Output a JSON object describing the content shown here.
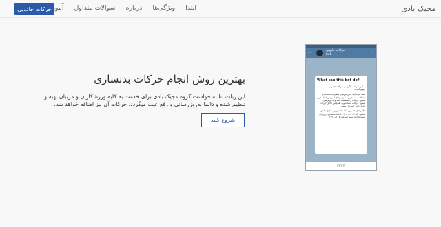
{
  "nav": {
    "brand": "مجیک بادی",
    "links": [
      "ابتدا",
      "ویژگی‌ها",
      "درباره",
      "سوالات متداول",
      "آموزش"
    ],
    "cta": "حرکات جادویی"
  },
  "hero": {
    "title": "بهترین روش انجام حرکات بدنسازی",
    "text": "این ربات بنا به خواست گروه مجیک بادی برای خدمت به کلیه ورزشکاران و مربیان تهیه و تنظیم شده و دائما به‌روزرسانی و رفع عیب میگردد، حرکات آن نیز اضافه خواهد شد.",
    "button": "شروع کنید"
  },
  "phone": {
    "header_name": "حرکات جادویی",
    "header_sub": "bot",
    "bubble_title": "What can this bot do?",
    "bubble_p1": "سلام به ربات تلگرامی حرکات جادویی خوش‌آمدید.",
    "bubble_p2": "شما می‌توانید به روش‌های متفاوت(دسته‌بندی عضلات، جستجو و...) ویدیوهای آموزش انجام فرم صحیح حرکات را مشاهده کنید و با روش‌های صحیح حرکات آشنا شوید. همچنین داخل حرکات جدید را نیز آموزش ببینید.",
    "bubble_p3": "کلاس‌های حضوری با استاد فرزین عباری: تلفن تماس: ۱۴۰۴۲۵۳ - ۰۹۱۲ ساعات تماس: روزهای شنبه تا چهارشنبه (ساعت ۱۸ الی ۱۹)",
    "start_label": "START"
  }
}
